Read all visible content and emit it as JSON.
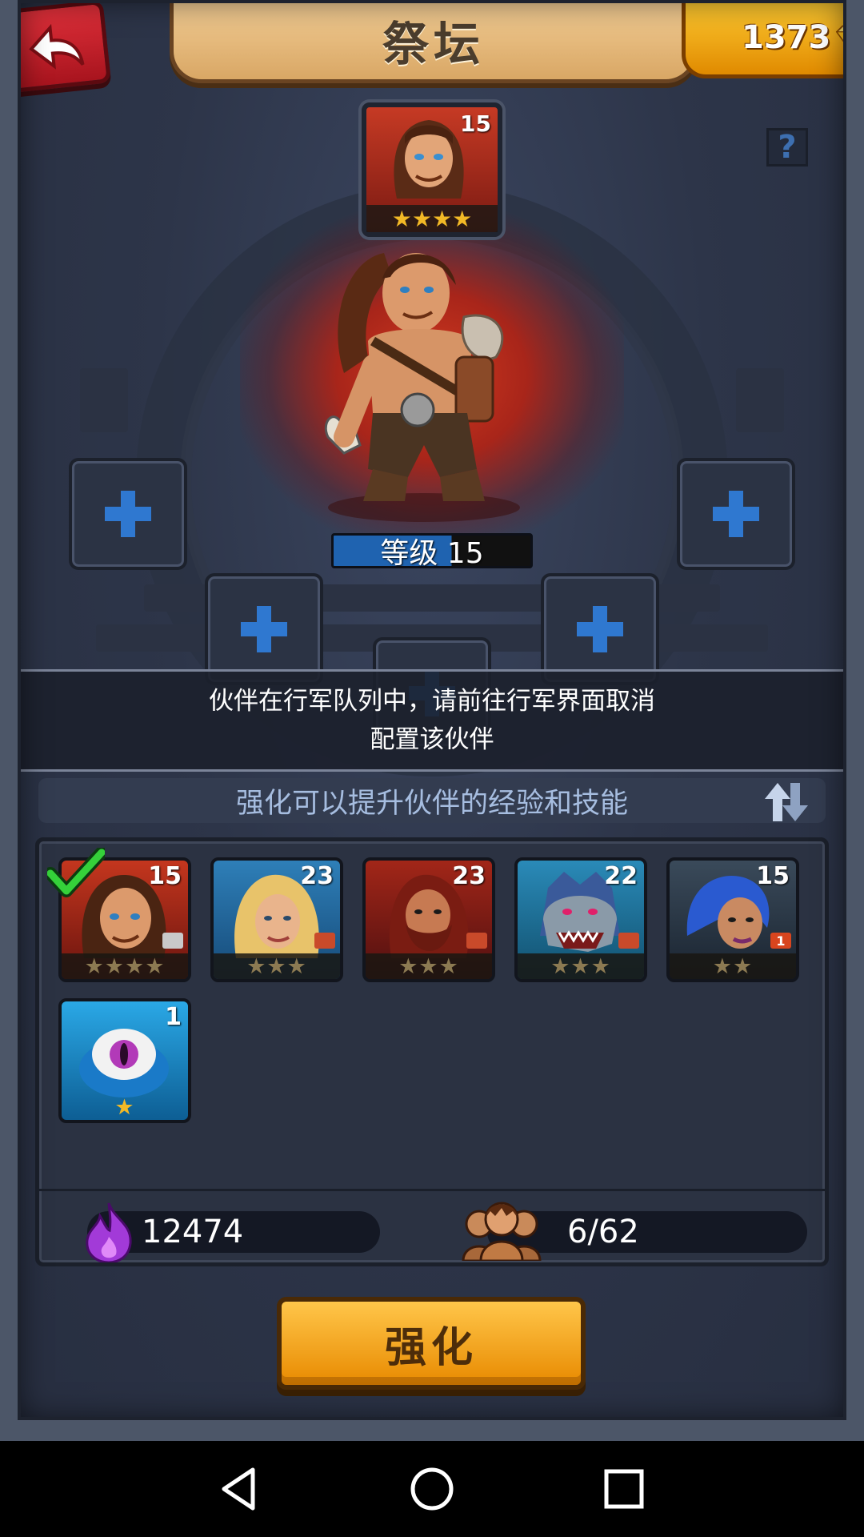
{
  "header": {
    "title": "祭坛",
    "gem_count": "1373",
    "help_label": "?"
  },
  "hero": {
    "portrait_level": "15",
    "portrait_stars": "★★★★",
    "level_label": "等级 15"
  },
  "notice": {
    "line1": "伙伴在行军队列中，请前往行军界面取消",
    "line2": "配置该伙伴"
  },
  "info_text": "强化可以提升伙伴的经验和技能",
  "roster": [
    {
      "name": "barbarian",
      "level": "15",
      "stars": "★★★★",
      "selected": true,
      "badge": ""
    },
    {
      "name": "blonde-warrior",
      "level": "23",
      "stars": "★★★",
      "selected": false,
      "badge": ""
    },
    {
      "name": "red-bearded-warrior",
      "level": "23",
      "stars": "★★★",
      "selected": false,
      "badge": ""
    },
    {
      "name": "werewolf",
      "level": "22",
      "stars": "★★★",
      "selected": false,
      "badge": ""
    },
    {
      "name": "blue-haired-rogue",
      "level": "15",
      "stars": "★★",
      "selected": false,
      "badge": "1"
    },
    {
      "name": "eyeball-monster",
      "level": "1",
      "stars": "★",
      "selected": false,
      "badge": ""
    }
  ],
  "stats": {
    "essence": "12474",
    "partners": "6/62"
  },
  "enhance_label": "强化",
  "colors": {
    "accent_gold": "#e88a00",
    "slot_plus": "#2f78d0",
    "star_gold": "#f2b926"
  }
}
